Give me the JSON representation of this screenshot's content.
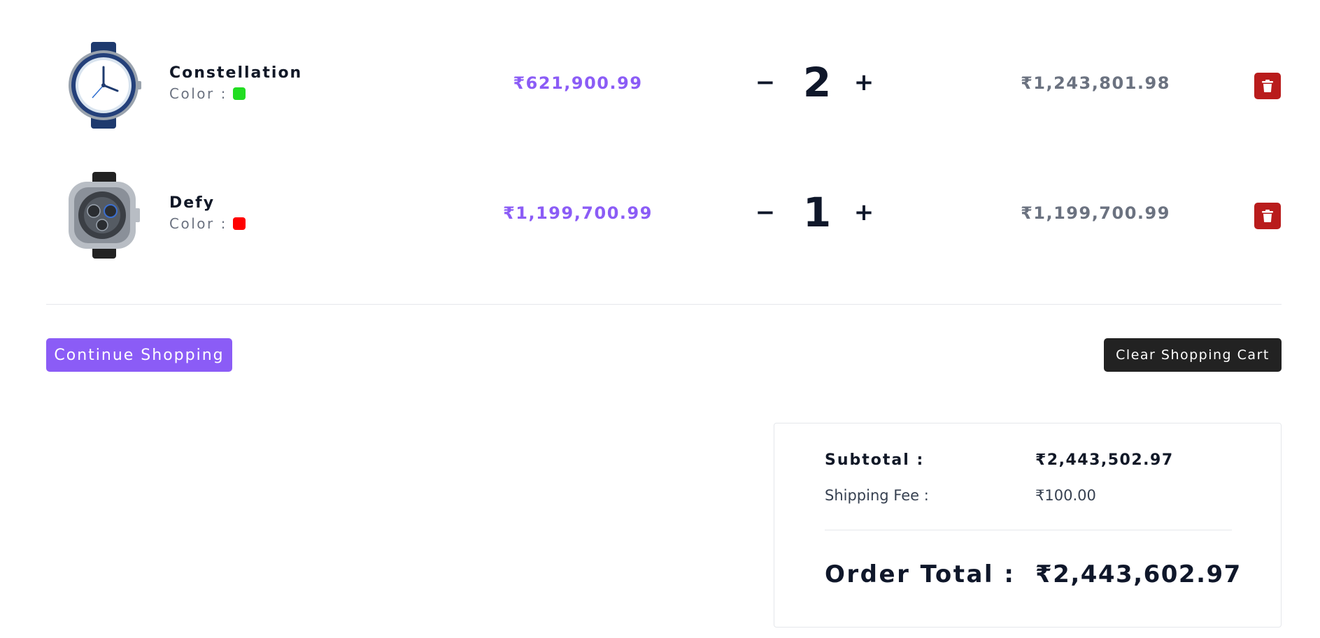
{
  "colors": {
    "accent": "#8b5cf6",
    "delete": "#b91c1c",
    "dark_button": "#222222",
    "muted_text": "#6b7280"
  },
  "cart": {
    "color_label": "Color :",
    "items": [
      {
        "name": "Constellation",
        "color_swatch": "#22dd22",
        "price": "₹621,900.99",
        "quantity": "2",
        "minus": "−",
        "plus": "+",
        "line_total": "₹1,243,801.98",
        "image_icon": "watch-constellation-image",
        "delete_icon": "trash-icon"
      },
      {
        "name": "Defy",
        "color_swatch": "#ff0000",
        "price": "₹1,199,700.99",
        "quantity": "1",
        "minus": "−",
        "plus": "+",
        "line_total": "₹1,199,700.99",
        "image_icon": "watch-defy-image",
        "delete_icon": "trash-icon"
      }
    ]
  },
  "actions": {
    "continue_label": "Continue Shopping",
    "clear_label": "Clear Shopping Cart"
  },
  "summary": {
    "subtotal_label": "Subtotal :",
    "subtotal_value": "₹2,443,502.97",
    "shipping_label": "Shipping Fee :",
    "shipping_value": "₹100.00",
    "total_label": "Order Total :",
    "total_value": "₹2,443,602.97"
  }
}
